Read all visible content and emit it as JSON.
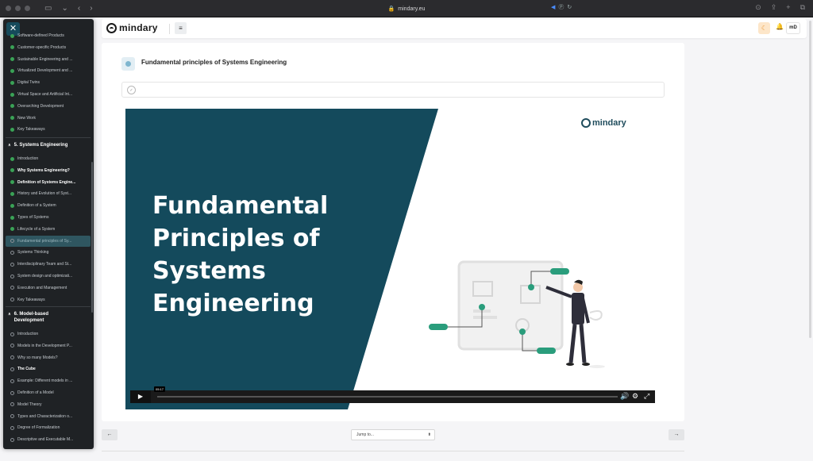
{
  "browser": {
    "url": "mindary.eu",
    "tab_indicator": "Ⓟ"
  },
  "app": {
    "brand": "mindary",
    "avatar_initials": "mD"
  },
  "sidebar": {
    "items_top": [
      {
        "label": "Software-defined Products",
        "status": "done"
      },
      {
        "label": "Customer-specific Products",
        "status": "done"
      },
      {
        "label": "Sustainable Engineering and ...",
        "status": "done"
      },
      {
        "label": "Virtualized Development and ...",
        "status": "done"
      },
      {
        "label": "Digital Twins",
        "status": "done"
      },
      {
        "label": "Virtual Space and Artificial Int...",
        "status": "done"
      },
      {
        "label": "Overarching Development",
        "status": "done"
      },
      {
        "label": "New Work",
        "status": "done"
      },
      {
        "label": "Key Takeaways",
        "status": "done"
      }
    ],
    "section5": "5. Systems Engineering",
    "items_s5": [
      {
        "label": "Introduction",
        "status": "done"
      },
      {
        "label": "Why Systems Engineering?",
        "status": "done",
        "bold": true
      },
      {
        "label": "Definition of Systems Engine...",
        "status": "done",
        "bold": true
      },
      {
        "label": "History and Evolution of Syst...",
        "status": "done"
      },
      {
        "label": "Definition of a System",
        "status": "done"
      },
      {
        "label": "Types of Systems",
        "status": "done"
      },
      {
        "label": "Lifecycle of a System",
        "status": "done"
      },
      {
        "label": "Fundamental principles of Sy...",
        "status": "open",
        "active": true
      },
      {
        "label": "Systems Thinking",
        "status": "open"
      },
      {
        "label": "Interdisciplinary Team and St...",
        "status": "open"
      },
      {
        "label": "System design and optimizati...",
        "status": "open"
      },
      {
        "label": "Execution and Management",
        "status": "open"
      },
      {
        "label": "Key Takeaways",
        "status": "open"
      }
    ],
    "section6_line1": "6. Model-based",
    "section6_line2": "Development",
    "items_s6": [
      {
        "label": "Introduction",
        "status": "open"
      },
      {
        "label": "Models in the Development P...",
        "status": "open"
      },
      {
        "label": "Why so many Models?",
        "status": "open"
      },
      {
        "label": "The Cube",
        "status": "open",
        "bold": true
      },
      {
        "label": "Example: Different models in ...",
        "status": "open"
      },
      {
        "label": "Definition of a Model",
        "status": "open"
      },
      {
        "label": "Model Theory",
        "status": "open"
      },
      {
        "label": "Types and Characterization o...",
        "status": "open"
      },
      {
        "label": "Degree of Formalization",
        "status": "open"
      },
      {
        "label": "Descriptive and Executable M...",
        "status": "open"
      }
    ]
  },
  "lesson": {
    "title": "Fundamental principles of Systems Engineering"
  },
  "video": {
    "slide_title": "Fundamental Principles of Systems Engineering",
    "slide_brand": "mindary",
    "time": "05:17",
    "accent": "#144a5c",
    "green": "#2a9d7c"
  },
  "nav": {
    "jump_placeholder": "Jump to..."
  }
}
